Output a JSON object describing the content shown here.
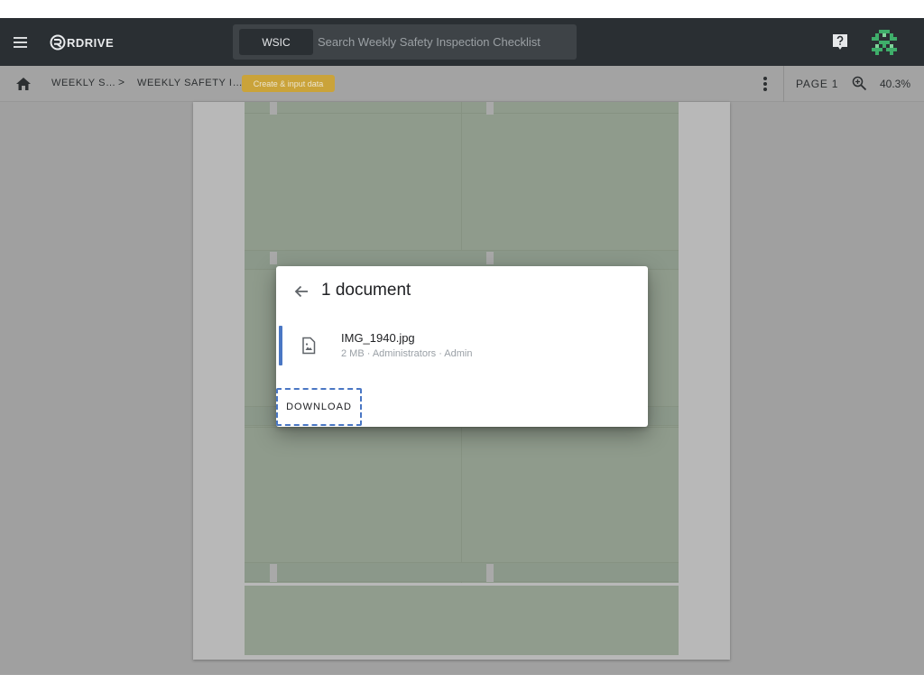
{
  "header": {
    "brand": "RDRIVE",
    "search": {
      "scope_label": "WSIC",
      "placeholder": "Search Weekly Safety Inspection Checklist"
    },
    "icons": {
      "menu": "menu-icon",
      "help": "help-icon",
      "avatar": "pixel-avatar-icon"
    }
  },
  "toolbar": {
    "breadcrumbs": [
      "WEEKLY S…",
      "WEEKLY SAFETY I…"
    ],
    "breadcrumb_separator": ">",
    "create_badge": "Create & input data",
    "page_label": "PAGE 1",
    "zoom": "40.3%"
  },
  "dialog": {
    "title": "1 document",
    "files": [
      {
        "name": "IMG_1940.jpg",
        "meta": "2 MB · Administrators · Admin",
        "icon": "image-file-icon"
      }
    ],
    "download_label": "DOWNLOAD"
  },
  "colors": {
    "topbar": "#2a2f33",
    "accent": "#4a77c4",
    "badge": "#caa33a"
  }
}
